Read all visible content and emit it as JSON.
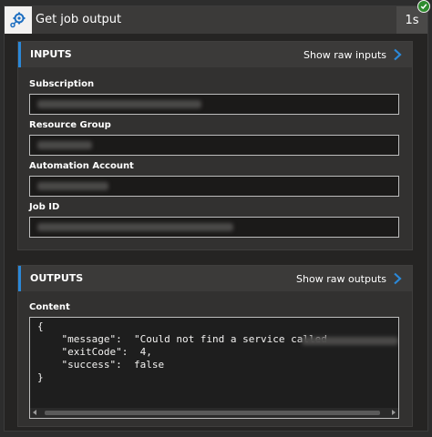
{
  "header": {
    "title": "Get job output",
    "duration": "1s",
    "icon": "automation-gear-icon",
    "status_icon": "success-check-icon"
  },
  "inputs": {
    "section_label": "INPUTS",
    "show_raw_label": "Show raw inputs",
    "fields": [
      {
        "label": "Subscription"
      },
      {
        "label": "Resource Group"
      },
      {
        "label": "Automation Account"
      },
      {
        "label": "Job ID"
      }
    ]
  },
  "outputs": {
    "section_label": "OUTPUTS",
    "show_raw_label": "Show raw outputs",
    "content_label": "Content",
    "code_lines": [
      "{",
      "    \"message\":  \"Could not find a service called",
      "    \"exitCode\":  4,",
      "    \"success\":  false",
      "}"
    ]
  },
  "colors": {
    "accent": "#2b88d8",
    "success": "#2e8b2e",
    "background": "#252423"
  }
}
